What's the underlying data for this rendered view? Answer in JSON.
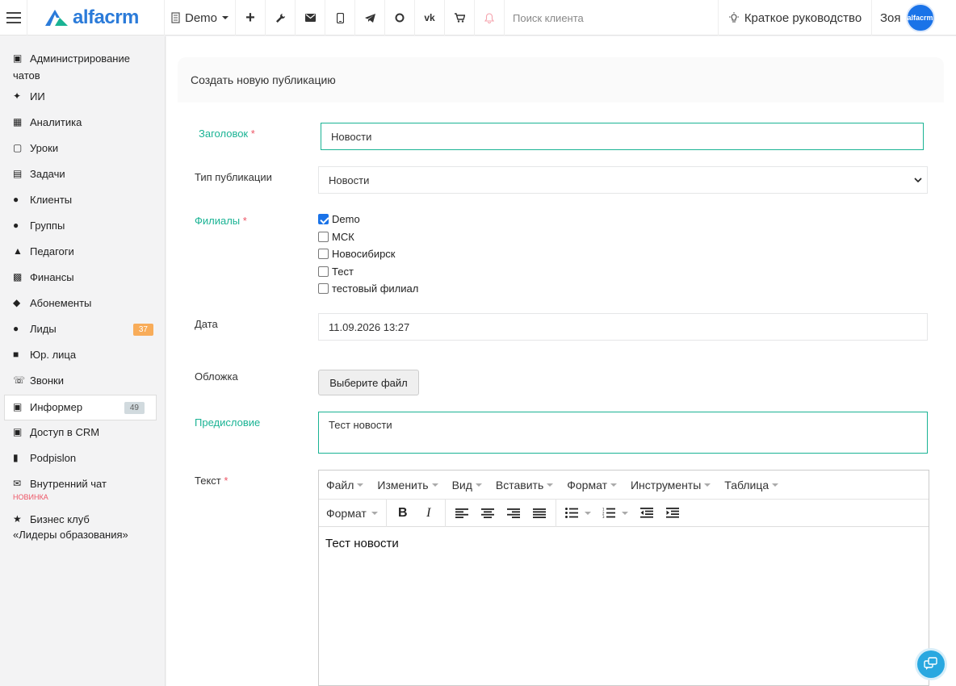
{
  "topbar": {
    "logo_text": "alfacrm",
    "branch": "Demo",
    "search_placeholder": "Поиск клиента",
    "guide": "Краткое руководство",
    "user_name": "Зоя",
    "avatar_text": "alfacrm",
    "icons": [
      "plus-icon",
      "wrench-icon",
      "mail-icon",
      "phone-icon",
      "telegram-icon",
      "chat-icon",
      "vk-icon",
      "cart-icon",
      "bell-icon"
    ]
  },
  "sidebar": {
    "items": [
      {
        "label": "Администрирование",
        "label2": "чатов",
        "icon": "chats-icon"
      },
      {
        "label": "ИИ",
        "icon": "sparkle-icon"
      },
      {
        "label": "Аналитика",
        "icon": "map-icon"
      },
      {
        "label": "Уроки",
        "icon": "calendar-icon"
      },
      {
        "label": "Задачи",
        "icon": "clipboard-icon"
      },
      {
        "label": "Клиенты",
        "icon": "user-icon"
      },
      {
        "label": "Группы",
        "icon": "users-icon"
      },
      {
        "label": "Педагоги",
        "icon": "graduation-cap-icon"
      },
      {
        "label": "Финансы",
        "icon": "money-icon"
      },
      {
        "label": "Абонементы",
        "icon": "tag-icon"
      },
      {
        "label": "Лиды",
        "icon": "user-plus-icon",
        "badge": "37"
      },
      {
        "label": "Юр. лица",
        "icon": "briefcase-icon"
      },
      {
        "label": "Звонки",
        "icon": "phone-icon"
      },
      {
        "label": "Информер",
        "icon": "informer-icon",
        "badge": "49"
      },
      {
        "label": "Доступ в CRM",
        "icon": "lock-icon"
      },
      {
        "label": "Podpislon",
        "icon": "file-icon"
      },
      {
        "label": "Внутренний чат",
        "icon": "envelope-icon",
        "sublabel": "НОВИНКА"
      },
      {
        "label": "Бизнес клуб",
        "label2": "«Лидеры образования»",
        "icon": "star-icon"
      }
    ]
  },
  "form": {
    "title": "Создать новую публикацию",
    "title_label": "Заголовок",
    "title_value": "Новости",
    "type_label": "Тип публикации",
    "type_value": "Новости",
    "branches_label": "Филиалы",
    "branches": [
      {
        "name": "Demo",
        "checked": true
      },
      {
        "name": "МСК",
        "checked": false
      },
      {
        "name": "Новосибирск",
        "checked": false
      },
      {
        "name": "Тест",
        "checked": false
      },
      {
        "name": "тестовый филиал",
        "checked": false
      }
    ],
    "date_label": "Дата",
    "date_value": "11.09.2026 13:27",
    "cover_label": "Обложка",
    "cover_button": "Выберите файл",
    "preface_label": "Предисловие",
    "preface_value": "Тест новости",
    "text_label": "Текст",
    "required_mark": "*"
  },
  "editor": {
    "menus": [
      "Файл",
      "Изменить",
      "Вид",
      "Вставить",
      "Формат",
      "Инструменты",
      "Таблица"
    ],
    "format_dropdown": "Формат",
    "content": "Тест новости"
  }
}
